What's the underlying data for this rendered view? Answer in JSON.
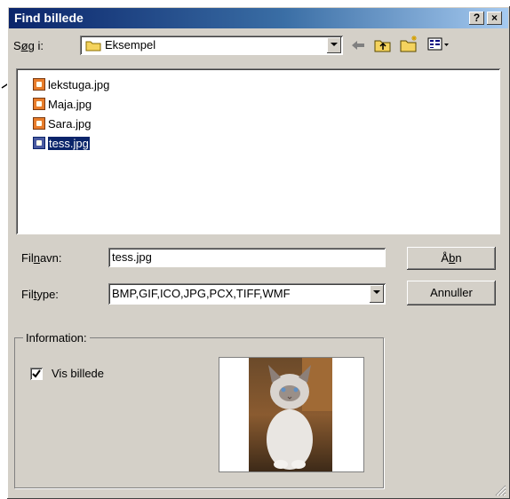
{
  "window": {
    "title": "Find billede",
    "help_label": "?",
    "close_label": "×"
  },
  "lookin": {
    "label_prefix": "S",
    "label_underlined": "ø",
    "label_suffix": "g i:",
    "folder": "Eksempel"
  },
  "files": [
    {
      "name": "lekstuga.jpg",
      "selected": false
    },
    {
      "name": "Maja.jpg",
      "selected": false
    },
    {
      "name": "Sara.jpg",
      "selected": false
    },
    {
      "name": "tess.jpg",
      "selected": true
    }
  ],
  "filename": {
    "label_prefix": "Fil",
    "label_underlined": "n",
    "label_suffix": "avn:",
    "value": "tess.jpg"
  },
  "filetype": {
    "label_prefix": "Fil",
    "label_underlined": "t",
    "label_suffix": "ype:",
    "value": "BMP,GIF,ICO,JPG,PCX,TIFF,WMF"
  },
  "buttons": {
    "open_prefix": "Å",
    "open_underlined": "b",
    "open_suffix": "n",
    "cancel": "Annuller"
  },
  "info": {
    "group_label": "Information:",
    "preview_checkbox_label": "Vis billede",
    "preview_checked": true
  },
  "icons": [
    "folder-icon",
    "back-arrow-icon",
    "up-folder-icon",
    "new-folder-icon",
    "view-menu-icon",
    "file-image-icon",
    "checkbox-check-icon",
    "annotation-arrow-icon",
    "cat-preview-image"
  ]
}
